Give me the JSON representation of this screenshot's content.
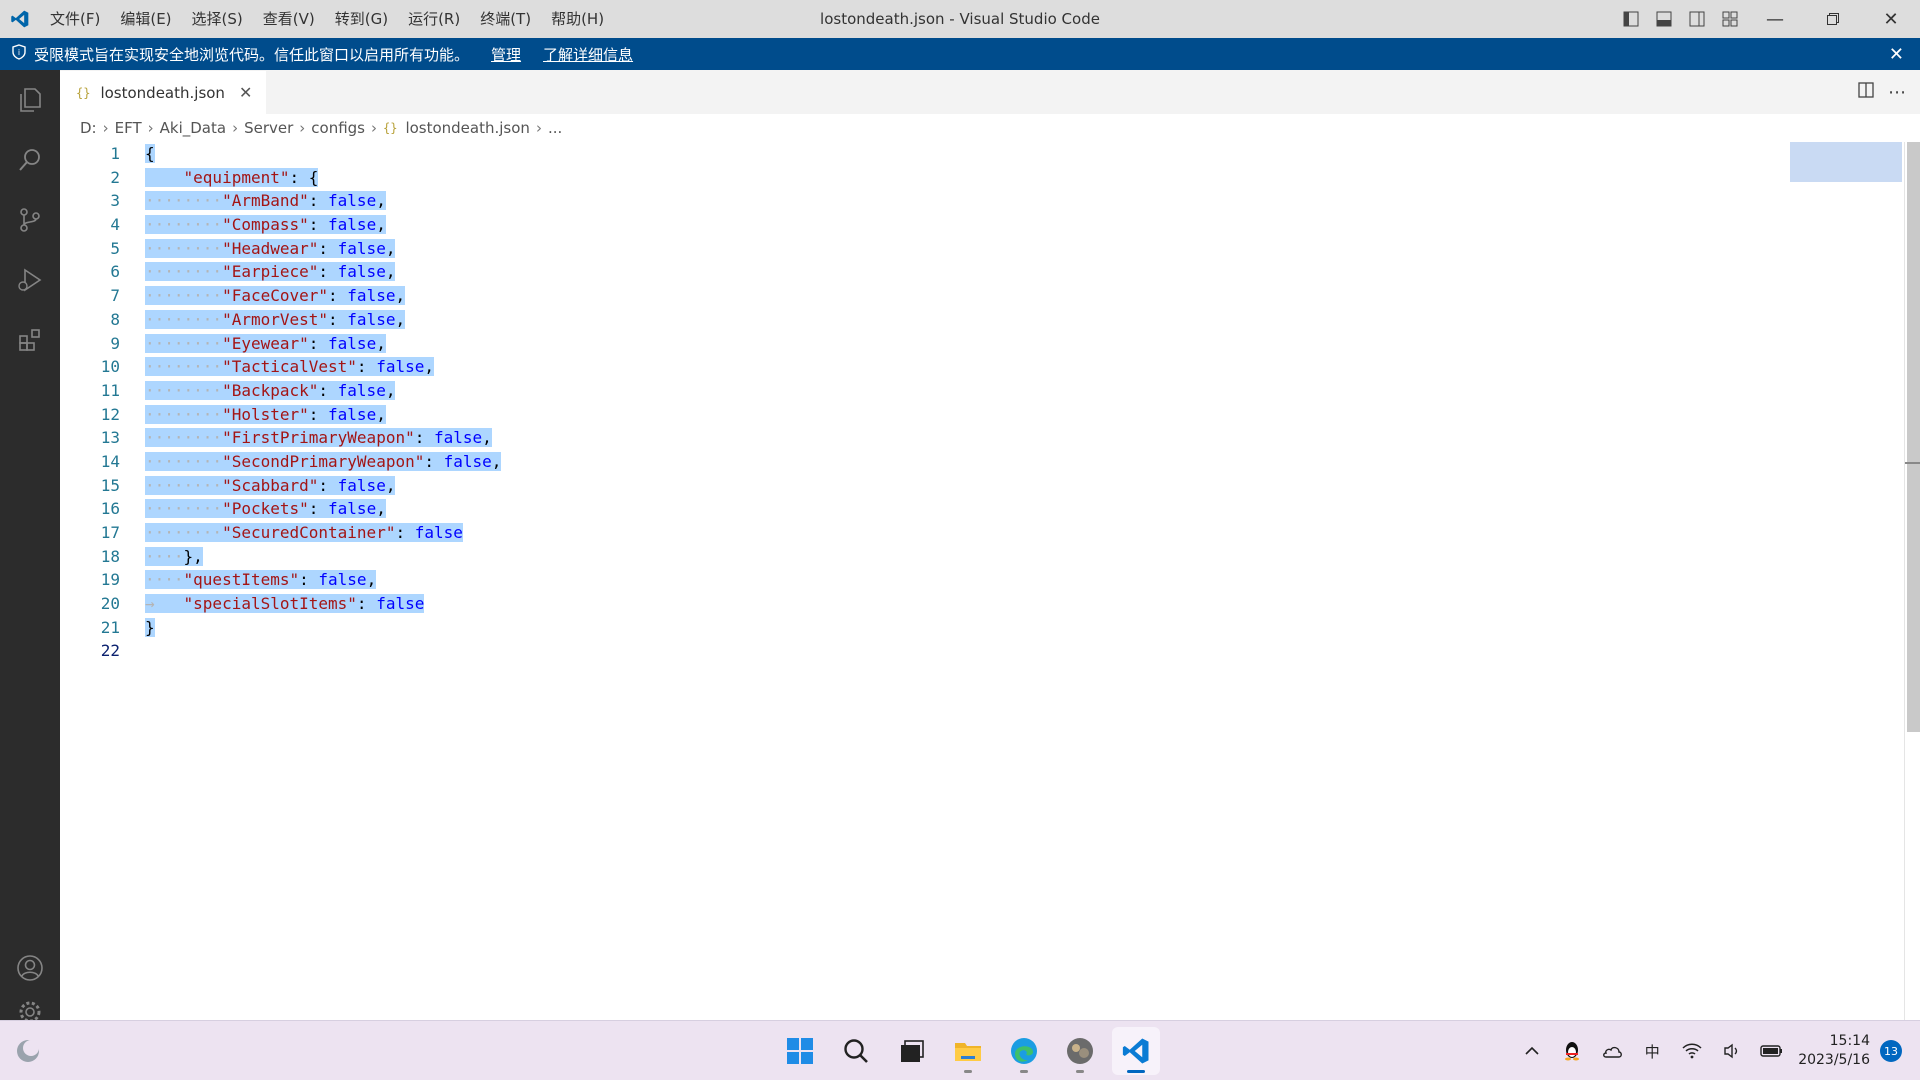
{
  "titlebar": {
    "menus": [
      "文件(F)",
      "编辑(E)",
      "选择(S)",
      "查看(V)",
      "转到(G)",
      "运行(R)",
      "终端(T)",
      "帮助(H)"
    ],
    "title": "lostondeath.json - Visual Studio Code"
  },
  "banner": {
    "message": "受限模式旨在实现安全地浏览代码。信任此窗口以启用所有功能。",
    "manage_label": "管理",
    "learn_more_label": "了解详细信息"
  },
  "tab": {
    "label": "lostondeath.json",
    "icon": "{}"
  },
  "breadcrumb": {
    "items": [
      "D:",
      "EFT",
      "Aki_Data",
      "Server",
      "configs",
      "lostondeath.json",
      "..."
    ],
    "icon": "{}"
  },
  "editor": {
    "line_numbers": [
      "1",
      "2",
      "3",
      "4",
      "5",
      "6",
      "7",
      "8",
      "9",
      "10",
      "11",
      "12",
      "13",
      "14",
      "15",
      "16",
      "17",
      "18",
      "19",
      "20",
      "21",
      "22"
    ],
    "lines": [
      {
        "indent": "",
        "text": "{",
        "selected_from": 0
      },
      {
        "indent": "    ",
        "key": "\"equipment\"",
        "rest": ": {"
      },
      {
        "indent": "········",
        "key": "\"ArmBand\"",
        "value": "false",
        "trail": ","
      },
      {
        "indent": "········",
        "key": "\"Compass\"",
        "value": "false",
        "trail": ","
      },
      {
        "indent": "········",
        "key": "\"Headwear\"",
        "value": "false",
        "trail": ","
      },
      {
        "indent": "········",
        "key": "\"Earpiece\"",
        "value": "false",
        "trail": ","
      },
      {
        "indent": "········",
        "key": "\"FaceCover\"",
        "value": "false",
        "trail": ","
      },
      {
        "indent": "········",
        "key": "\"ArmorVest\"",
        "value": "false",
        "trail": ","
      },
      {
        "indent": "········",
        "key": "\"Eyewear\"",
        "value": "false",
        "trail": ","
      },
      {
        "indent": "········",
        "key": "\"TacticalVest\"",
        "value": "false",
        "trail": ","
      },
      {
        "indent": "········",
        "key": "\"Backpack\"",
        "value": "false",
        "trail": ","
      },
      {
        "indent": "········",
        "key": "\"Holster\"",
        "value": "false",
        "trail": ","
      },
      {
        "indent": "········",
        "key": "\"FirstPrimaryWeapon\"",
        "value": "false",
        "trail": ","
      },
      {
        "indent": "········",
        "key": "\"SecondPrimaryWeapon\"",
        "value": "false",
        "trail": ","
      },
      {
        "indent": "········",
        "key": "\"Scabbard\"",
        "value": "false",
        "trail": ","
      },
      {
        "indent": "········",
        "key": "\"Pockets\"",
        "value": "false",
        "trail": ","
      },
      {
        "indent": "········",
        "key": "\"SecuredContainer\"",
        "value": "false",
        "trail": ""
      },
      {
        "indent": "····",
        "text": "},"
      },
      {
        "indent": "····",
        "key": "\"questItems\"",
        "value": "false",
        "trail": ","
      },
      {
        "indent": "→   ",
        "key": "\"specialSlotItems\"",
        "value": "false",
        "trail": ""
      },
      {
        "indent": "",
        "text": "}"
      },
      {
        "indent": "",
        "text": ""
      }
    ]
  },
  "taskbar": {
    "time": "15:14",
    "date": "2023/5/16",
    "notification_count": "13",
    "ime": "中"
  },
  "colors": {
    "accent": "#007acc",
    "banner": "#004c8c",
    "selection": "#add6ff",
    "json_key": "#a31515",
    "json_keyword": "#0000ff"
  }
}
